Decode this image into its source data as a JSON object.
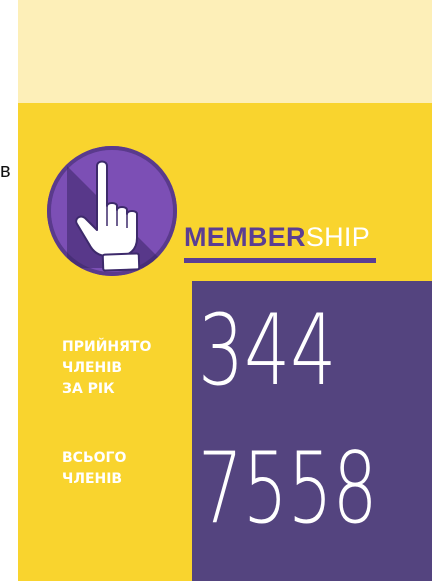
{
  "side_letter": "в",
  "brand": {
    "bold_part": "MEMBER",
    "light_part": "SHIP"
  },
  "stats": [
    {
      "label_lines": [
        "ПРИЙНЯТО",
        "ЧЛЕНІВ",
        "ЗА РІК"
      ],
      "value": "344"
    },
    {
      "label_lines": [
        "ВСЬОГО",
        "ЧЛЕНІВ"
      ],
      "value": "7558"
    }
  ],
  "icons": {
    "logo": "hand-pointer-icon"
  },
  "colors": {
    "top_panel": "#FDEFB8",
    "main_panel": "#F9D42E",
    "stats_panel": "#54447F",
    "logo_circle": "#6E45A6",
    "brand_purple": "#5B3E93"
  }
}
